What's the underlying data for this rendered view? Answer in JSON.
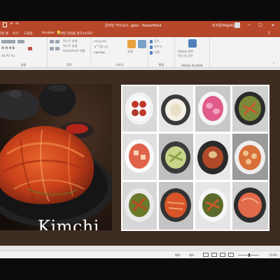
{
  "titlebar": {
    "title": "온라인 카드뉴스 .pptx - PowerPoint",
    "user": "이지은04@4240",
    "minimize": "─",
    "restore": "☐",
    "close": "✕"
  },
  "tabs": [
    "파일",
    "홈",
    "삽입",
    "디자인",
    "전환",
    "애니메이션",
    "보기",
    "도움말",
    "Acrobat"
  ],
  "tell_me": "어떤 작업을 원하시나요?",
  "ribbon": {
    "groups": {
      "font": "글꼴",
      "paragraph": "단락",
      "drawing": "그리기",
      "editing": "편집",
      "adobe": "Adobe Acrobat"
    },
    "paragraph_items": [
      "텍스트 방향",
      "텍스트 맞춤",
      "SmartArt로 변환"
    ],
    "editing_items": [
      "찾기",
      "바꾸기",
      "선택"
    ],
    "arrange_label": "정렬",
    "adobe_label": [
      "Adobe PDF",
      "작성 및 공유"
    ]
  },
  "slide": {
    "title_word": "Kimchi"
  },
  "statusbar": {
    "notes": "메모",
    "comments": "메모",
    "zoom": "112%"
  },
  "colors": {
    "ribbon_accent": "#b7472a",
    "slide_background": "#3e2c23"
  }
}
